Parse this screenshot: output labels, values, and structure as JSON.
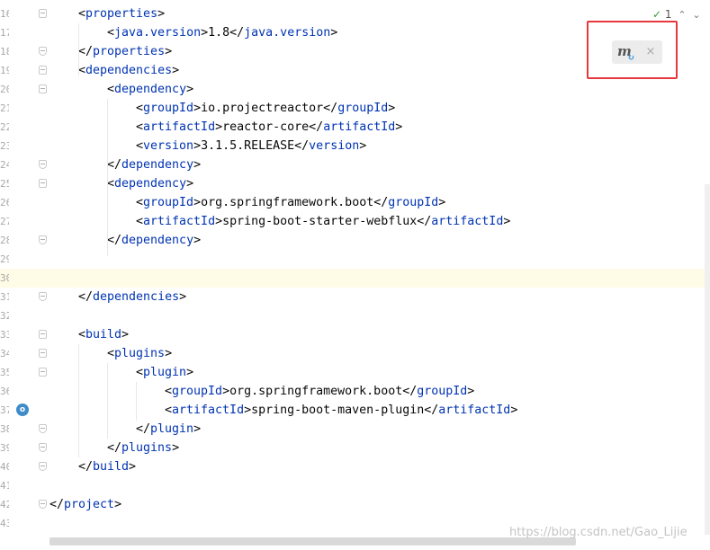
{
  "editor": {
    "lines": [
      {
        "num": "16",
        "indent": 1,
        "open": "<",
        "tag": "properties",
        "close": ">",
        "text": "",
        "end": "",
        "fold": "start"
      },
      {
        "num": "17",
        "indent": 2,
        "open": "<",
        "tag": "java.version",
        "close": ">",
        "text": "1.8",
        "end": "</java.version>",
        "fold": ""
      },
      {
        "num": "18",
        "indent": 1,
        "open": "</",
        "tag": "properties",
        "close": ">",
        "text": "",
        "end": "",
        "fold": "end"
      },
      {
        "num": "19",
        "indent": 1,
        "open": "<",
        "tag": "dependencies",
        "close": ">",
        "text": "",
        "end": "",
        "fold": "start"
      },
      {
        "num": "20",
        "indent": 2,
        "open": "<",
        "tag": "dependency",
        "close": ">",
        "text": "",
        "end": "",
        "fold": "start"
      },
      {
        "num": "21",
        "indent": 3,
        "open": "<",
        "tag": "groupId",
        "close": ">",
        "text": "io.projectreactor",
        "end": "</groupId>",
        "fold": ""
      },
      {
        "num": "22",
        "indent": 3,
        "open": "<",
        "tag": "artifactId",
        "close": ">",
        "text": "reactor-core",
        "end": "</artifactId>",
        "fold": ""
      },
      {
        "num": "23",
        "indent": 3,
        "open": "<",
        "tag": "version",
        "close": ">",
        "text": "3.1.5.RELEASE",
        "end": "</version>",
        "fold": ""
      },
      {
        "num": "24",
        "indent": 2,
        "open": "</",
        "tag": "dependency",
        "close": ">",
        "text": "",
        "end": "",
        "fold": "end"
      },
      {
        "num": "25",
        "indent": 2,
        "open": "<",
        "tag": "dependency",
        "close": ">",
        "text": "",
        "end": "",
        "fold": "start"
      },
      {
        "num": "26",
        "indent": 3,
        "open": "<",
        "tag": "groupId",
        "close": ">",
        "text": "org.springframework.boot",
        "end": "</groupId>",
        "fold": ""
      },
      {
        "num": "27",
        "indent": 3,
        "open": "<",
        "tag": "artifactId",
        "close": ">",
        "text": "spring-boot-starter-webflux",
        "end": "</artifactId>",
        "fold": ""
      },
      {
        "num": "28",
        "indent": 2,
        "open": "</",
        "tag": "dependency",
        "close": ">",
        "text": "",
        "end": "",
        "fold": "end"
      },
      {
        "num": "29",
        "indent": 0,
        "open": "",
        "tag": "",
        "close": "",
        "text": "",
        "end": "",
        "fold": ""
      },
      {
        "num": "30",
        "indent": 0,
        "open": "",
        "tag": "",
        "close": "",
        "text": "",
        "end": "",
        "fold": "",
        "current": true
      },
      {
        "num": "31",
        "indent": 1,
        "open": "</",
        "tag": "dependencies",
        "close": ">",
        "text": "",
        "end": "",
        "fold": "end"
      },
      {
        "num": "32",
        "indent": 0,
        "open": "",
        "tag": "",
        "close": "",
        "text": "",
        "end": "",
        "fold": ""
      },
      {
        "num": "33",
        "indent": 1,
        "open": "<",
        "tag": "build",
        "close": ">",
        "text": "",
        "end": "",
        "fold": "start"
      },
      {
        "num": "34",
        "indent": 2,
        "open": "<",
        "tag": "plugins",
        "close": ">",
        "text": "",
        "end": "",
        "fold": "start"
      },
      {
        "num": "35",
        "indent": 3,
        "open": "<",
        "tag": "plugin",
        "close": ">",
        "text": "",
        "end": "",
        "fold": "start"
      },
      {
        "num": "36",
        "indent": 4,
        "open": "<",
        "tag": "groupId",
        "close": ">",
        "text": "org.springframework.boot",
        "end": "</groupId>",
        "fold": ""
      },
      {
        "num": "37",
        "indent": 4,
        "open": "<",
        "tag": "artifactId",
        "close": ">",
        "text": "spring-boot-maven-plugin",
        "end": "</artifactId>",
        "fold": "",
        "gutter_icon": true
      },
      {
        "num": "38",
        "indent": 3,
        "open": "</",
        "tag": "plugin",
        "close": ">",
        "text": "",
        "end": "",
        "fold": "end"
      },
      {
        "num": "39",
        "indent": 2,
        "open": "</",
        "tag": "plugins",
        "close": ">",
        "text": "",
        "end": "",
        "fold": "end"
      },
      {
        "num": "40",
        "indent": 1,
        "open": "</",
        "tag": "build",
        "close": ">",
        "text": "",
        "end": "",
        "fold": "end"
      },
      {
        "num": "41",
        "indent": 0,
        "open": "",
        "tag": "",
        "close": "",
        "text": "",
        "end": "",
        "fold": ""
      },
      {
        "num": "42",
        "indent": 0,
        "open": "</",
        "tag": "project",
        "close": ">",
        "text": "",
        "end": "",
        "fold": "end"
      },
      {
        "num": "43",
        "indent": 0,
        "open": "",
        "tag": "",
        "close": "",
        "text": "",
        "end": "",
        "fold": ""
      }
    ]
  },
  "inspections": {
    "count": "1",
    "check_icon": "check-icon",
    "up_icon": "chevron-up-icon",
    "down_icon": "chevron-down-icon"
  },
  "maven_popup": {
    "icon": "maven-reload-icon",
    "icon_letter": "m",
    "sync_glyph": "↻",
    "close_glyph": "×"
  },
  "watermark": "https://blog.csdn.net/Gao_Lijie",
  "colors": {
    "tag": "#0033b3",
    "current_line": "#fefbe6",
    "highlight_box": "#e8383d"
  }
}
